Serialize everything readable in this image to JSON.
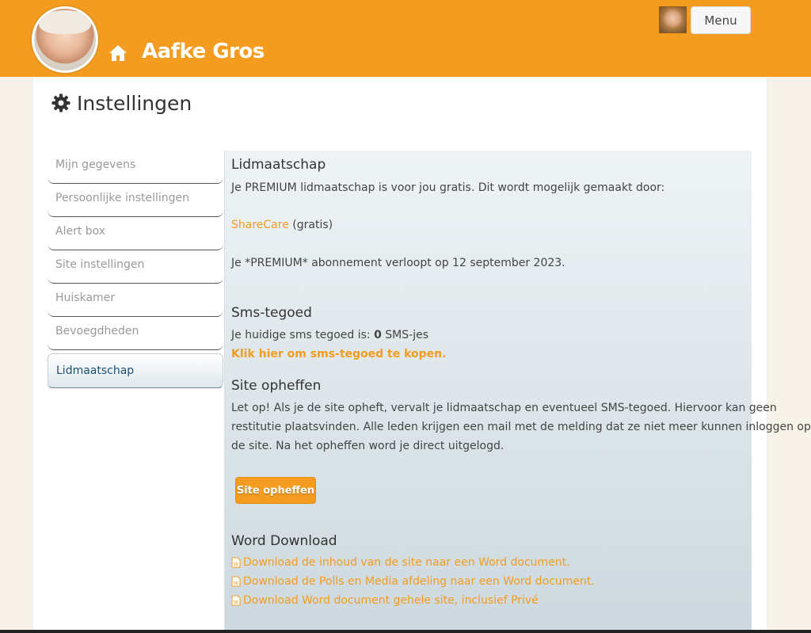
{
  "header": {
    "site_name": "Aafke Gros",
    "menu_label": "Menu",
    "home_icon": "home-icon"
  },
  "page": {
    "title": "Instellingen",
    "title_icon": "gear-icon"
  },
  "sidebar": {
    "items": [
      {
        "label": "Mijn gegevens",
        "active": false
      },
      {
        "label": "Persoonlijke instellingen",
        "active": false
      },
      {
        "label": "Alert box",
        "active": false
      },
      {
        "label": "Site instellingen",
        "active": false
      },
      {
        "label": "Huiskamer",
        "active": false
      },
      {
        "label": "Bevoegdheden",
        "active": false
      },
      {
        "label": "Lidmaatschap",
        "active": true
      }
    ]
  },
  "membership": {
    "heading": "Lidmaatschap",
    "intro": "Je PREMIUM lidmaatschap is voor jou gratis. Dit wordt mogelijk gemaakt door:",
    "sponsor_link": "ShareCare",
    "sponsor_suffix": "(gratis)",
    "expiry": "Je *PREMIUM* abonnement verloopt op 12 september 2023."
  },
  "sms": {
    "heading": "Sms-tegoed",
    "label_prefix": "Je huidige sms tegoed is:",
    "count": "0",
    "label_suffix": "SMS-jes",
    "buy_link": "Klik hier om sms-tegoed te kopen."
  },
  "cancel": {
    "heading": "Site opheffen",
    "line1": "Let op! Als je de site opheft, vervalt je lidmaatschap en eventueel SMS-tegoed. Hiervoor kan geen",
    "line2": "restitutie plaatsvinden. Alle leden krijgen een mail met de melding dat ze niet meer kunnen inloggen op",
    "line3": "de site. Na het opheffen word je direct uitgelogd.",
    "button_label": "Site opheffen"
  },
  "word": {
    "heading": "Word Download",
    "links": [
      "Download de inhoud van de site naar een Word document.",
      "Download de Polls en Media afdeling naar een Word document.",
      "Download Word document gehele site, inclusief Privé"
    ]
  },
  "colors": {
    "accent": "#f39c1f",
    "background": "#f7f3e8"
  }
}
